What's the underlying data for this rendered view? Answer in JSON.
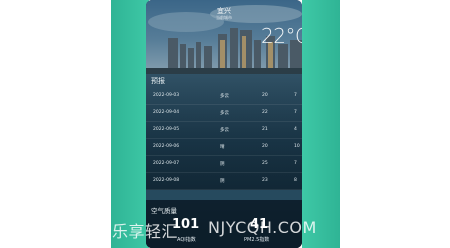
{
  "header": {
    "city": "宜兴",
    "subtitle": "当前城市",
    "temperature": "22°C"
  },
  "forecast": {
    "title": "预报",
    "rows": [
      {
        "date": "2022-09-03",
        "condition": "多云",
        "high": "20",
        "low": "7"
      },
      {
        "date": "2022-09-04",
        "condition": "多云",
        "high": "22",
        "low": "7"
      },
      {
        "date": "2022-09-05",
        "condition": "多云",
        "high": "21",
        "low": "4"
      },
      {
        "date": "2022-09-06",
        "condition": "晴",
        "high": "20",
        "low": "10"
      },
      {
        "date": "2022-09-07",
        "condition": "阴",
        "high": "25",
        "low": "7"
      },
      {
        "date": "2022-09-08",
        "condition": "阴",
        "high": "23",
        "low": "8"
      }
    ]
  },
  "air_quality": {
    "title": "空气质量",
    "aqi_value": "101",
    "aqi_label": "AQI指数",
    "pm25_value": "41",
    "pm25_label": "PM2.5指数"
  },
  "watermark": {
    "text_cn": "乐享轻汇",
    "text_en": "NJYCQH.COM"
  },
  "colors": {
    "frame": "#3ec8a6",
    "sky": "#2a4a66",
    "water": "#1d3f55"
  }
}
